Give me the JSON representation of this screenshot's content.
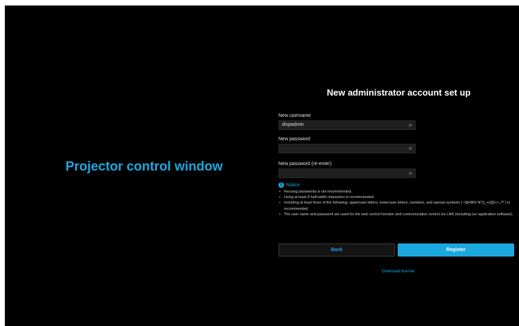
{
  "brand_title": "Projector control window",
  "form": {
    "title": "New administrator account set up",
    "username": {
      "label": "New username",
      "value": "dispadmin",
      "clear": "×"
    },
    "password": {
      "label": "New password",
      "value": "",
      "clear": "×"
    },
    "password_confirm": {
      "label": "New password (re-enter)",
      "value": "",
      "clear": "×"
    }
  },
  "notice": {
    "icon": "info-icon",
    "icon_glyph": "i",
    "title": "Notice",
    "items": [
      "Reusing passwords is not recommended.",
      "Using at least 8 half-width characters is recommended.",
      "Including at least three of the following: uppercase letters, lowercase letters, numbers, and special symbols (~!@#$%^&*()_+|{}[]<>.,/?`) is recommended.",
      "The user name and password are used for the web control function and communication control via LAN (including our application software)."
    ]
  },
  "buttons": {
    "back": "Back",
    "register": "Register"
  },
  "download_link": "Download license",
  "colors": {
    "background": "#000000",
    "accent": "#1ba8e0",
    "field": "#1f1f1f"
  }
}
